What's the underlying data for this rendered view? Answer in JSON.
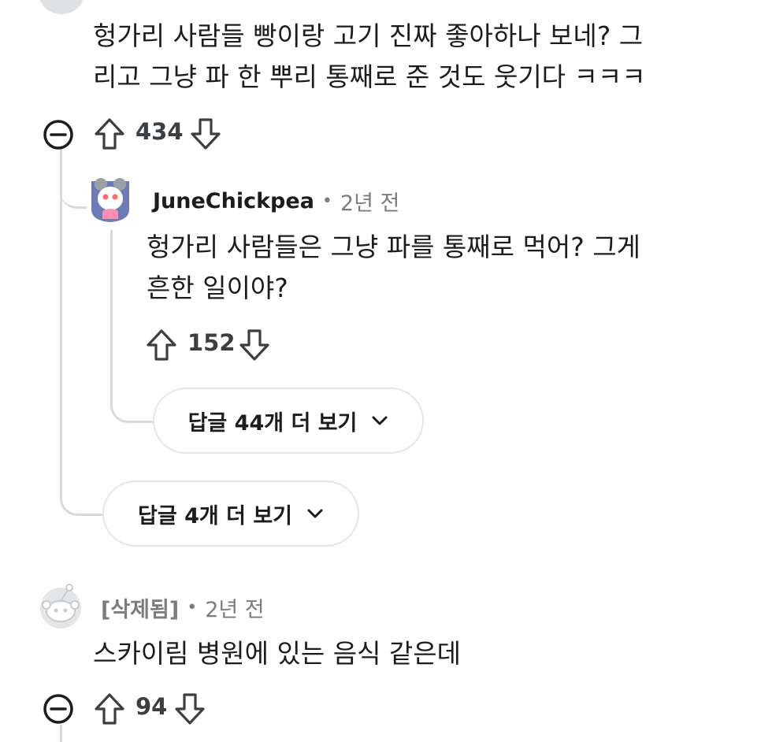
{
  "comment1": {
    "line1": "헝가리 사람들 빵이랑 고기 진짜 좋아하나 보네? 그",
    "line2": "리고 그냥 파 한 뿌리 통째로 준 것도 웃기다 ㅋㅋㅋ",
    "votes": "434"
  },
  "reply1": {
    "username": "JuneChickpea",
    "dot": "•",
    "time": "2년 전",
    "line1": "헝가리 사람들은 그냥 파를 통째로 먹어? 그게",
    "line2": "흔한 일이야?",
    "votes": "152",
    "more_replies": "답글 44개 더 보기"
  },
  "thread_more_replies": "답글 4개 더 보기",
  "comment2": {
    "username": "[삭제됨]",
    "dot": "•",
    "time": "2년 전",
    "text": "스카이림 병원에 있는 음식 같은데",
    "votes": "94"
  },
  "colors": {
    "thread_line": "#d7dadc",
    "icon": "#3c3f42",
    "meta": "#7c7c7c"
  }
}
